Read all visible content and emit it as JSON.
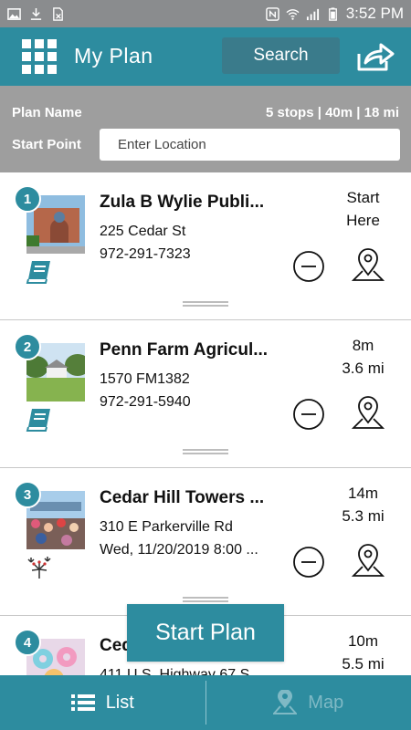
{
  "status_bar": {
    "time": "3:52 PM",
    "icons": [
      "image-icon",
      "download-icon",
      "no-sim-icon",
      "nfc-icon",
      "wifi-icon",
      "signal-icon",
      "battery-icon"
    ]
  },
  "header": {
    "title": "My Plan",
    "search_label": "Search",
    "icons": [
      "grid-menu-icon",
      "share-icon"
    ]
  },
  "plan": {
    "name_label": "Plan Name",
    "summary": "5 stops | 40m | 18 mi",
    "start_label": "Start Point",
    "location_placeholder": "Enter Location"
  },
  "stops": [
    {
      "number": "1",
      "name": "Zula B Wylie Publi...",
      "line1": "225 Cedar St",
      "line2": "972-291-7323",
      "meta1": "Start",
      "meta2": "Here",
      "category_icon": "book-icon"
    },
    {
      "number": "2",
      "name": "Penn Farm Agricul...",
      "line1": "1570 FM1382",
      "line2": "972-291-5940",
      "meta1": "8m",
      "meta2": "3.6 mi",
      "category_icon": "book-icon"
    },
    {
      "number": "3",
      "name": "Cedar Hill Towers ...",
      "line1": "310 E Parkerville Rd",
      "line2": "Wed, 11/20/2019 8:00 ...",
      "meta1": "14m",
      "meta2": "5.3 mi",
      "category_icon": "fireworks-icon"
    },
    {
      "number": "4",
      "name": "Ced",
      "line1": "411 U.S. Highway 67 S",
      "line2": "",
      "meta1": "10m",
      "meta2": "5.5 mi",
      "category_icon": ""
    }
  ],
  "start_plan_label": "Start Plan",
  "tabs": {
    "list_label": "List",
    "map_label": "Map"
  },
  "colors": {
    "brand": "#2d8c9f",
    "search_button": "#3a7b8b",
    "plan_bar": "#9e9e9e",
    "status_bar": "#8a8c8e"
  }
}
